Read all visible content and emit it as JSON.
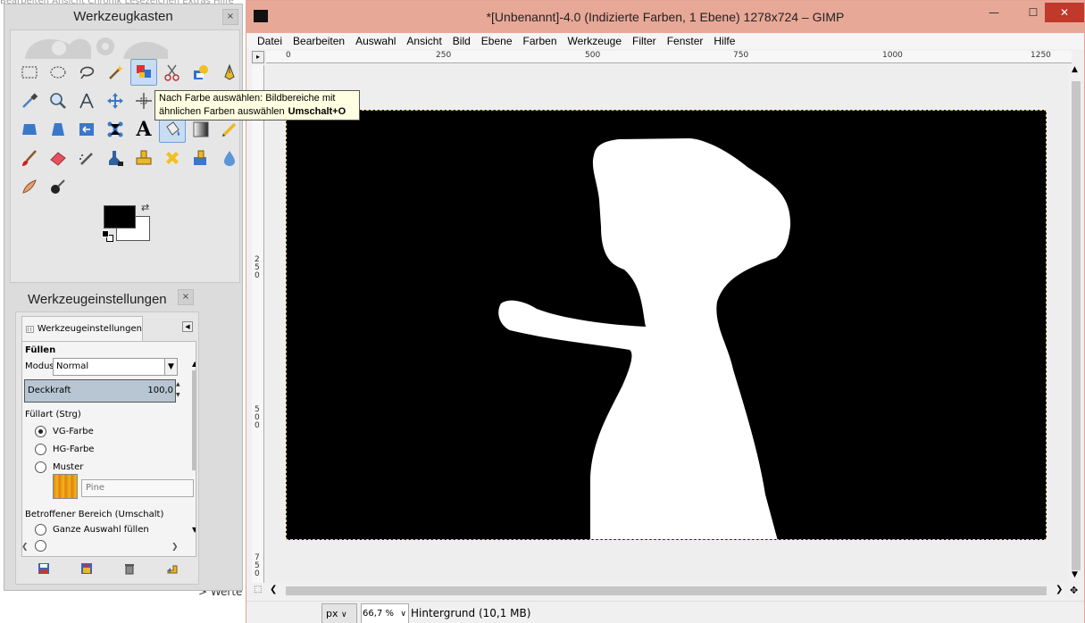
{
  "background": {
    "menu_text": "Bearbeiten  Ansicht  Chronik  Lesezeichen  Extras  Hilfe",
    "partial_word": "> Werte"
  },
  "toolbox": {
    "title": "Werkzeugkasten",
    "close": "×",
    "tools": [
      {
        "name": "rect-select-tool-icon"
      },
      {
        "name": "ellipse-select-tool-icon"
      },
      {
        "name": "free-select-tool-icon"
      },
      {
        "name": "fuzzy-select-tool-icon"
      },
      {
        "name": "select-by-color-tool-icon"
      },
      {
        "name": "scissors-select-tool-icon"
      },
      {
        "name": "foreground-select-tool-icon"
      },
      {
        "name": "paths-tool-icon"
      },
      {
        "name": "color-picker-tool-icon"
      },
      {
        "name": "zoom-tool-icon"
      },
      {
        "name": "measure-tool-icon"
      },
      {
        "name": "move-tool-icon"
      },
      {
        "name": "align-tool-icon"
      },
      {
        "name": "crop-tool-icon"
      },
      {
        "name": "rotate-tool-icon"
      },
      {
        "name": "scale-tool-icon"
      },
      {
        "name": "shear-tool-icon"
      },
      {
        "name": "perspective-tool-icon"
      },
      {
        "name": "flip-tool-icon"
      },
      {
        "name": "cage-tool-icon"
      },
      {
        "name": "text-tool-icon"
      },
      {
        "name": "bucket-fill-tool-icon"
      },
      {
        "name": "blend-tool-icon"
      },
      {
        "name": "pencil-tool-icon"
      },
      {
        "name": "paintbrush-tool-icon"
      },
      {
        "name": "eraser-tool-icon"
      },
      {
        "name": "airbrush-tool-icon"
      },
      {
        "name": "ink-tool-icon"
      },
      {
        "name": "clone-tool-icon"
      },
      {
        "name": "heal-tool-icon"
      },
      {
        "name": "perspective-clone-tool-icon"
      },
      {
        "name": "blur-tool-icon"
      },
      {
        "name": "smudge-tool-icon"
      },
      {
        "name": "dodge-burn-tool-icon"
      }
    ],
    "text_tool_glyph": "A",
    "foreground_color": "#000000",
    "background_color": "#ffffff"
  },
  "tooltip": {
    "line1": "Nach Farbe auswählen: Bildbereiche mit",
    "line2": "ähnlichen Farben auswählen",
    "shortcut": "Umschalt+O"
  },
  "tool_options": {
    "title": "Werkzeugeinstellungen",
    "close": "×",
    "tab_label": "Werkzeugeinstellungen",
    "section": "Füllen",
    "mode_label": "Modus:",
    "mode_value": "Normal",
    "opacity_label": "Deckkraft",
    "opacity_value": "100,0",
    "fill_type_label": "Füllart  (Strg)",
    "fill_options": [
      "VG-Farbe",
      "HG-Farbe",
      "Muster"
    ],
    "fill_selected": "VG-Farbe",
    "pattern_name": "Pine",
    "affected_label": "Betroffener Bereich (Umschalt)",
    "affected_option": "Ganze Auswahl füllen"
  },
  "gimp": {
    "title": "*[Unbenannt]-4.0 (Indizierte Farben, 1 Ebene) 1278x724 – GIMP",
    "window_buttons": {
      "minimize": "—",
      "maximize": "☐",
      "close": "✕"
    },
    "menu": [
      "Datei",
      "Bearbeiten",
      "Auswahl",
      "Ansicht",
      "Bild",
      "Ebene",
      "Farben",
      "Werkzeuge",
      "Filter",
      "Fenster",
      "Hilfe"
    ],
    "ruler_h_labels": [
      "0",
      "250",
      "500",
      "750",
      "1000",
      "1250"
    ],
    "ruler_v_labels": [
      "2\n5\n0",
      "5\n0\n0",
      "7\n5\n0"
    ],
    "status": {
      "unit": "px",
      "zoom": "66,7 %",
      "layer_info": "Hintergrund (10,1 MB)"
    }
  }
}
